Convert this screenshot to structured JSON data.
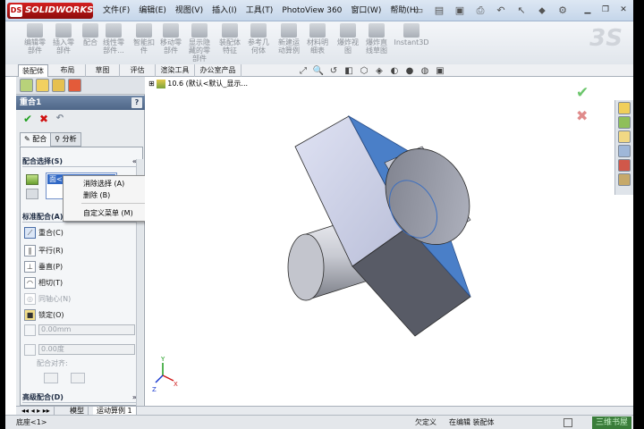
{
  "app": {
    "brand": "SOLIDWORKS",
    "logo_mark": "DS"
  },
  "menu": [
    "文件(F)",
    "编辑(E)",
    "视图(V)",
    "插入(I)",
    "工具(T)",
    "PhotoView 360",
    "窗口(W)",
    "帮助(H)"
  ],
  "command_manager": {
    "buttons": [
      "编辑零部件",
      "插入零部件",
      "配合",
      "线性零部件...",
      "智能扣件",
      "移动零部件",
      "显示隐藏的零部件",
      "装配体特征",
      "参考几何体",
      "新建运动算例",
      "材料明细表",
      "爆炸视图",
      "爆炸直线草图",
      "Instant3D"
    ],
    "tabs": [
      "装配体",
      "布局",
      "草图",
      "评估",
      "渲染工具",
      "办公室产品"
    ],
    "active_tab": "装配体"
  },
  "property_manager": {
    "title": "重合1",
    "help": "?",
    "tabs": [
      "配合",
      "分析"
    ],
    "active_tab": "配合",
    "group_mate_selections": "配合选择(S)",
    "group_standard_mates": "标准配合(A)",
    "group_advanced_mates": "高级配合(D)",
    "selection_item": "面<1>@底座-1",
    "standard_mates": [
      "重合(C)",
      "平行(R)",
      "垂直(P)",
      "相切(T)",
      "同轴心(N)",
      "锁定(O)"
    ],
    "distance_value": "0.00mm",
    "angle_value": "0.00度",
    "mate_alignment_label": "配合对齐:"
  },
  "context_menu": {
    "items": [
      "消除选择  (A)",
      "删除  (B)",
      "自定义菜单 (M)"
    ]
  },
  "graphics": {
    "tree_flyout": "10.6  (默认<默认_显示..."
  },
  "bottom_tabs": [
    "模型",
    "运动算例 1"
  ],
  "active_bottom_tab": "运动算例 1",
  "status": {
    "left": "底座<1>",
    "state": "欠定义",
    "mode": "在编辑 装配体",
    "watermark": "三维书屋"
  },
  "colors": {
    "selected_face": "#4a7fc8",
    "titlebar": "#c5d6ea",
    "pm_title": "#5a7396",
    "ok_check": "#20a020",
    "cancel_x": "#d01010"
  }
}
